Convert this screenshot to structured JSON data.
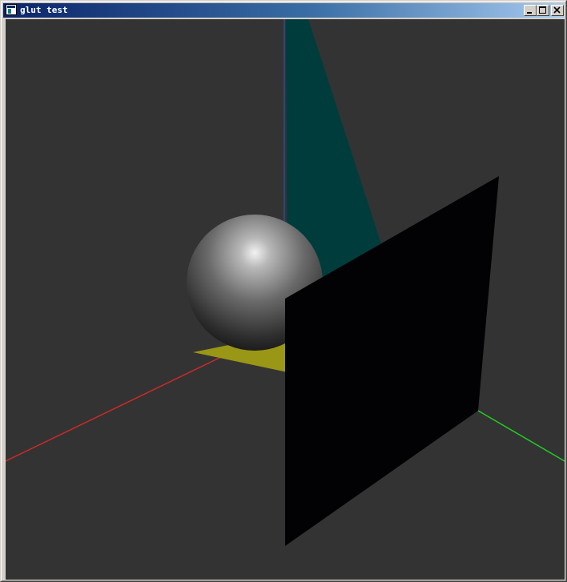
{
  "window": {
    "title": "glut test"
  },
  "titlebar": {
    "icon": "app-window-icon",
    "controls": [
      {
        "name": "minimize",
        "icon": "minimize-icon"
      },
      {
        "name": "maximize",
        "icon": "maximize-icon"
      },
      {
        "name": "close",
        "icon": "close-icon"
      }
    ]
  },
  "scene": {
    "background_color": "#333333",
    "objects": [
      {
        "name": "x-axis",
        "color": "#cc2a2a"
      },
      {
        "name": "y-axis",
        "color": "#22cc22"
      },
      {
        "name": "z-axis",
        "color": "#2a4a9a"
      },
      {
        "name": "sphere",
        "color": "#9a9a9a"
      },
      {
        "name": "floor-triangle",
        "color": "#9a9616"
      },
      {
        "name": "cyan-triangle",
        "color": "#003c3c"
      },
      {
        "name": "black-plane",
        "color": "#020204"
      }
    ]
  }
}
